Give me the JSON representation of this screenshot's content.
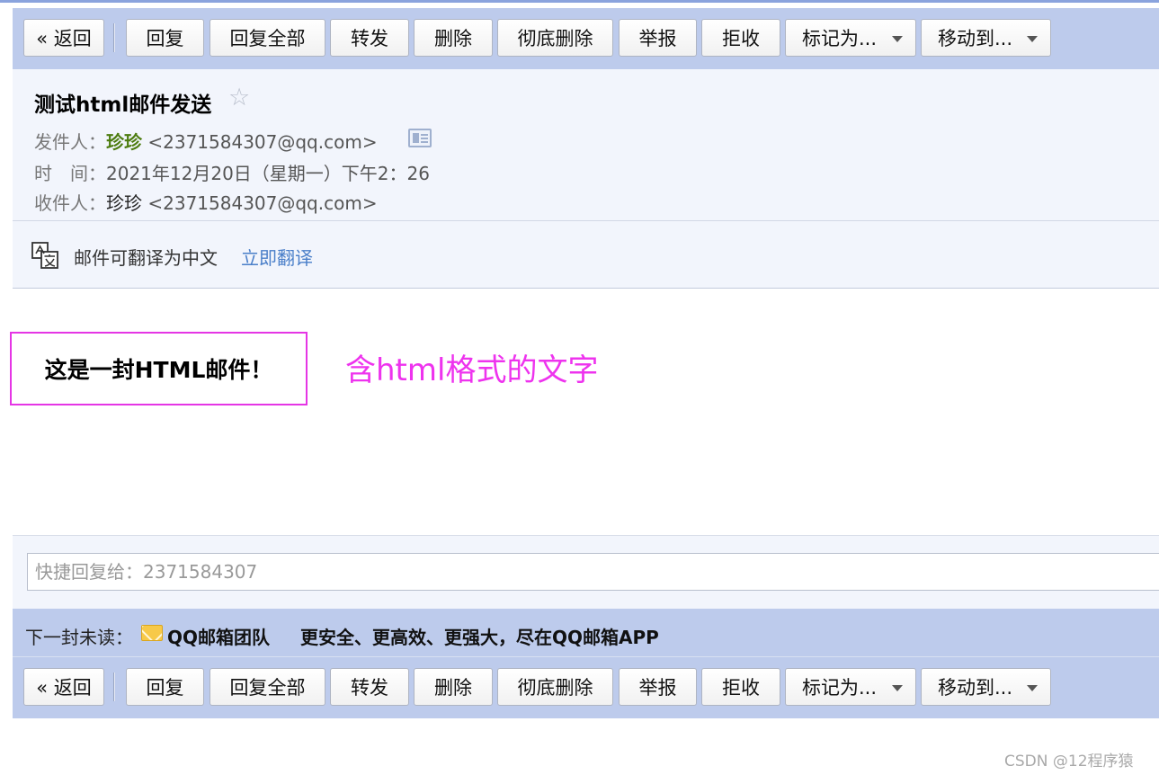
{
  "toolbar": {
    "back": "« 返回",
    "reply": "回复",
    "reply_all": "回复全部",
    "forward": "转发",
    "delete": "删除",
    "delete_permanently": "彻底删除",
    "report": "举报",
    "reject": "拒收",
    "mark_as": "标记为...",
    "move_to": "移动到..."
  },
  "mail": {
    "subject": "测试html邮件发送",
    "star_glyph": "☆",
    "from_label": "发件人：",
    "from_name": "珍珍",
    "from_addr": "<2371584307@qq.com>",
    "time_label": "时　间：",
    "time_value": "2021年12月20日（星期一）下午2：26",
    "to_label": "收件人：",
    "to_name": "珍珍",
    "to_addr": "<2371584307@qq.com>"
  },
  "translate": {
    "notice": "邮件可翻译为中文",
    "action": "立即翻译"
  },
  "body": {
    "content": "这是一封HTML邮件！",
    "annotation": "含html格式的文字"
  },
  "quick_reply": {
    "placeholder": "快捷回复给：2371584307"
  },
  "next_unread": {
    "label": "下一封未读：",
    "sender": "QQ邮箱团队",
    "subject": "更安全、更高效、更强大，尽在QQ邮箱APP"
  },
  "watermark": "CSDN @12程序猿",
  "colors": {
    "toolbar_bg": "#bdcbec",
    "header_bg": "#f2f5fc",
    "sender_name": "#4d7c0f",
    "link": "#4a7fc9",
    "highlight_border": "#e535e5",
    "annotation_text": "#ee33ee"
  }
}
